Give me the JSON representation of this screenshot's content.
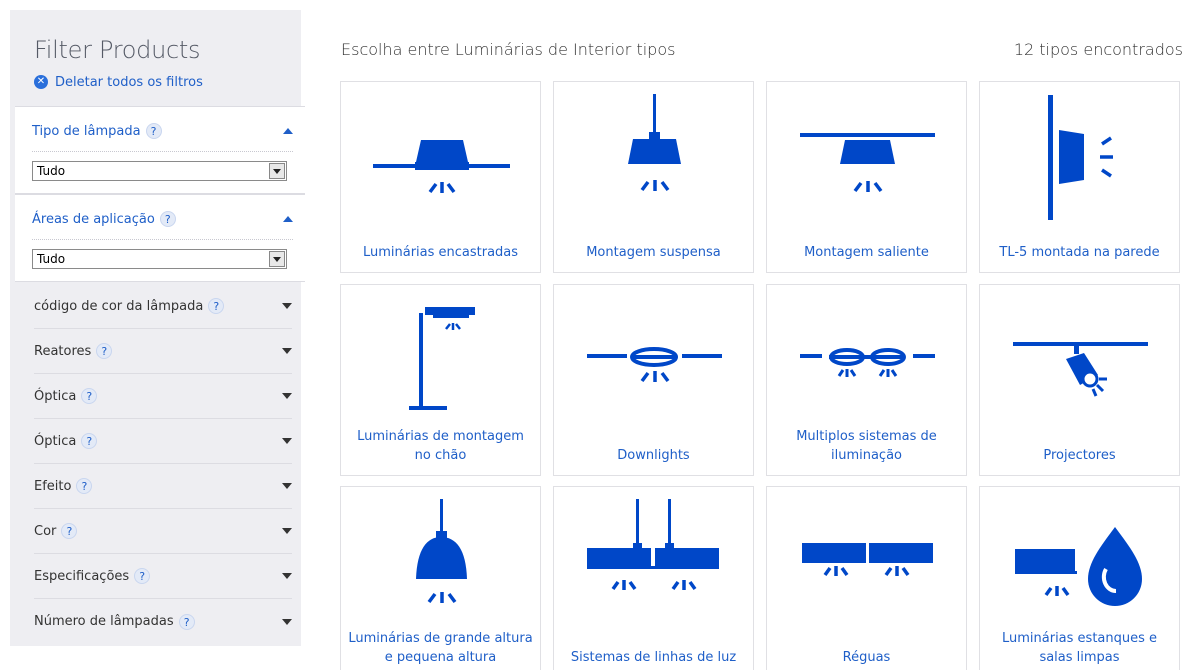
{
  "sidebar": {
    "title": "Filter Products",
    "clear_filters": "Deletar todos os filtros",
    "help_glyph": "?",
    "open_filters": [
      {
        "label": "Tipo de lâmpada",
        "selected": "Tudo"
      },
      {
        "label": "Áreas de aplicação",
        "selected": "Tudo"
      }
    ],
    "filters": [
      {
        "label": "código de cor da lâmpada"
      },
      {
        "label": "Reatores"
      },
      {
        "label": "Óptica"
      },
      {
        "label": "Óptica"
      },
      {
        "label": "Efeito"
      },
      {
        "label": "Cor"
      },
      {
        "label": "Especificações"
      },
      {
        "label": "Número de lâmpadas"
      }
    ]
  },
  "main": {
    "title": "Escolha entre Luminárias de Interior tipos",
    "count": "12 tipos encontrados",
    "tiles": [
      {
        "caption": "Luminárias encastradas",
        "icon": "recessed-luminaire-icon"
      },
      {
        "caption": "Montagem suspensa",
        "icon": "suspended-luminaire-icon"
      },
      {
        "caption": "Montagem saliente",
        "icon": "surface-mounted-icon"
      },
      {
        "caption": "TL-5 montada na parede",
        "icon": "wall-mounted-icon"
      },
      {
        "caption": "Luminárias de montagem no chão",
        "icon": "floor-standing-icon"
      },
      {
        "caption": "Downlights",
        "icon": "downlight-icon"
      },
      {
        "caption": "Multiplos sistemas de iluminação",
        "icon": "multiple-systems-icon"
      },
      {
        "caption": "Projectores",
        "icon": "projector-icon"
      },
      {
        "caption": "Luminárias de grande altura e pequena altura",
        "icon": "highbay-lowbay-icon"
      },
      {
        "caption": "Sistemas de linhas de luz",
        "icon": "light-line-systems-icon"
      },
      {
        "caption": "Réguas",
        "icon": "battens-icon"
      },
      {
        "caption": "Luminárias estanques e salas limpas",
        "icon": "waterproof-cleanroom-icon"
      }
    ]
  },
  "colors": {
    "accent": "#0047c8",
    "link": "#1f5fc8",
    "sidebar_bg": "#eeeef2"
  }
}
